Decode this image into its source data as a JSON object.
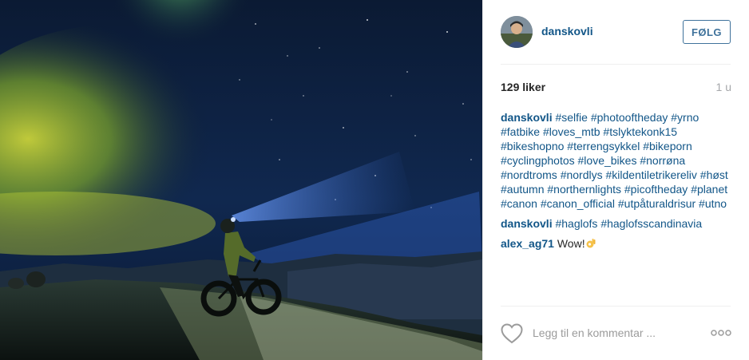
{
  "photo": {
    "alt": "Cyclist with headlamp on a fat bike under the northern lights"
  },
  "header": {
    "username": "danskovli",
    "follow_label": "FØLG"
  },
  "stats": {
    "likes": "129 liker",
    "time": "1 u"
  },
  "caption": {
    "username": "danskovli",
    "tags": [
      "#selfie",
      "#photooftheday",
      "#yrno",
      "#fatbike",
      "#loves_mtb",
      "#tslyktekonk15",
      "#bikeshopno",
      "#terrengsykkel",
      "#bikeporn",
      "#cyclingphotos",
      "#love_bikes",
      "#norrøna",
      "#nordtroms",
      "#nordlys",
      "#kildentiletrikereliv",
      "#høst",
      "#autumn",
      "#northernlights",
      "#picoftheday",
      "#planet",
      "#canon",
      "#canon_official",
      "#utpåturaldrisur",
      "#utno"
    ]
  },
  "comments": [
    {
      "username": "danskovli",
      "tags": [
        "#haglofs",
        "#haglofsscandinavia"
      ]
    },
    {
      "username": "alex_ag71",
      "text": "Wow!",
      "emoji": "ok-hand-emoji"
    }
  ],
  "comment_box": {
    "placeholder": "Legg til en kommentar ..."
  },
  "icons": {
    "like": "heart-outline-icon",
    "more": "more-options-icon"
  },
  "colors": {
    "link": "#125688",
    "follow": "#3f729b",
    "muted": "#a5a7aa"
  }
}
